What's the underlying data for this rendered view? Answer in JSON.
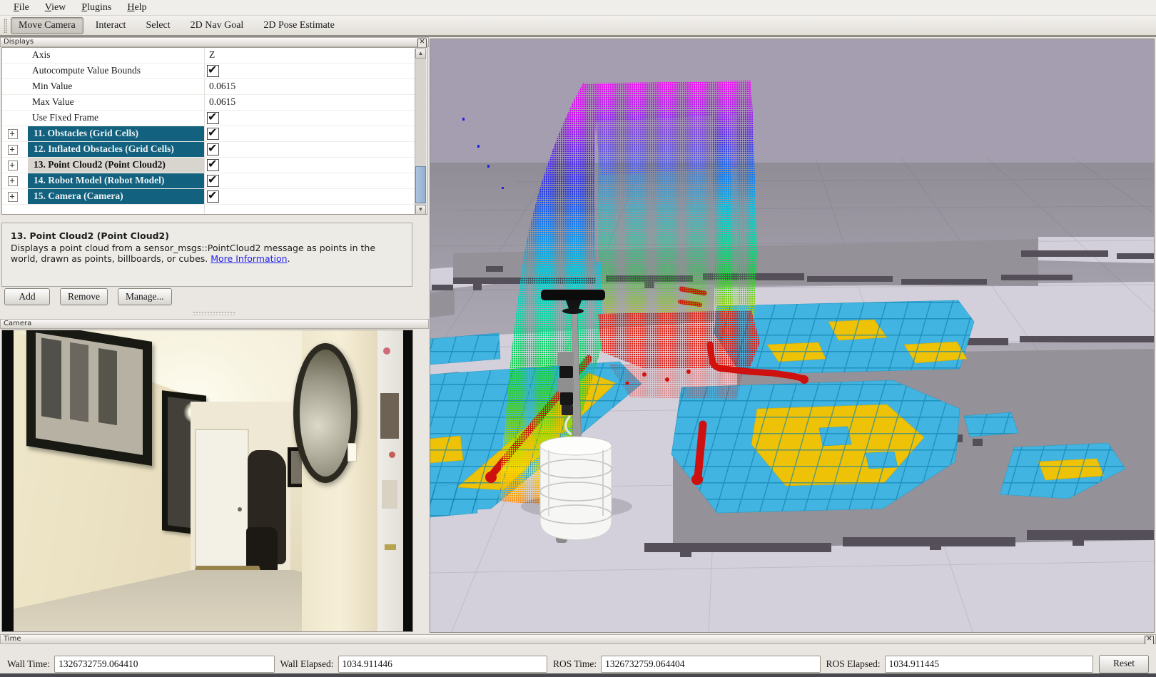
{
  "menu": {
    "items": [
      {
        "label": "File"
      },
      {
        "label": "View"
      },
      {
        "label": "Plugins"
      },
      {
        "label": "Help"
      }
    ]
  },
  "toolbar": {
    "tools": [
      {
        "label": "Move Camera",
        "active": true
      },
      {
        "label": "Interact",
        "active": false
      },
      {
        "label": "Select",
        "active": false
      },
      {
        "label": "2D Nav Goal",
        "active": false
      },
      {
        "label": "2D Pose Estimate",
        "active": false
      }
    ]
  },
  "displays_panel": {
    "title": "Displays",
    "properties": [
      {
        "name": "Axis",
        "value": "Z"
      },
      {
        "name": "Autocompute Value Bounds",
        "checked": true
      },
      {
        "name": "Min Value",
        "value": "0.0615"
      },
      {
        "name": "Max Value",
        "value": "0.0615"
      },
      {
        "name": "Use Fixed Frame",
        "checked": true
      }
    ],
    "items": [
      {
        "label": "11. Obstacles (Grid Cells)",
        "checked": true
      },
      {
        "label": "12. Inflated Obstacles (Grid Cells)",
        "checked": true
      },
      {
        "label": "13. Point Cloud2 (Point Cloud2)",
        "checked": true
      },
      {
        "label": "14. Robot Model (Robot Model)",
        "checked": true
      },
      {
        "label": "15. Camera (Camera)",
        "checked": true
      }
    ],
    "description": {
      "heading": "13. Point Cloud2 (Point Cloud2)",
      "body": "Displays a point cloud from a sensor_msgs::PointCloud2 message as points in the world, drawn as points, billboards, or cubes. ",
      "link": "More Information",
      "suffix": "."
    },
    "buttons": {
      "add": "Add",
      "remove": "Remove",
      "manage": "Manage..."
    }
  },
  "camera_panel": {
    "title": "Camera"
  },
  "time_panel": {
    "title": "Time",
    "fields": [
      {
        "label": "Wall Time:",
        "value": "1326732759.064410"
      },
      {
        "label": "Wall Elapsed:",
        "value": "1034.911446"
      },
      {
        "label": "ROS Time:",
        "value": "1326732759.064404"
      },
      {
        "label": "ROS Elapsed:",
        "value": "1034.911445"
      }
    ],
    "reset_label": "Reset"
  },
  "colors": {
    "selection_teal": "#11617f",
    "costmap_blue": "#41b4e1",
    "costmap_yellow": "#eec307",
    "laser_red": "#ce100e",
    "sky": "#a59db0"
  }
}
